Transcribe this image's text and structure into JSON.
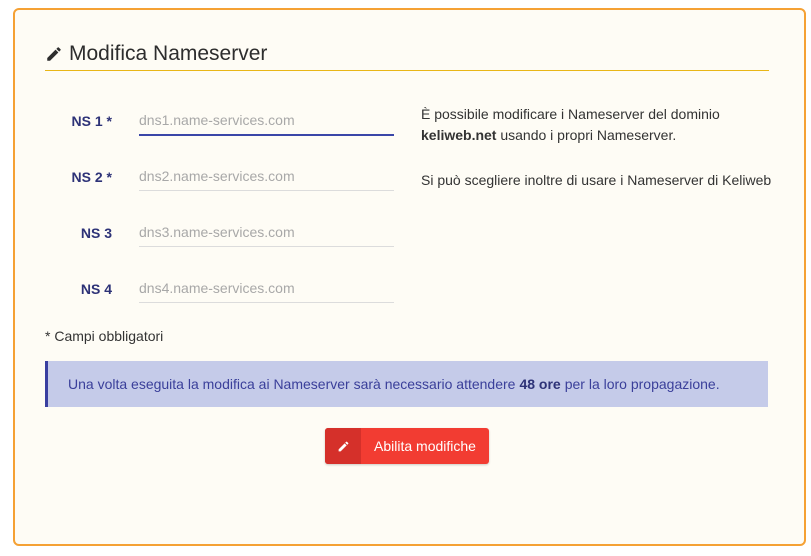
{
  "card": {
    "title": "Modifica Nameserver",
    "title_icon": "pencil-icon"
  },
  "fields": [
    {
      "label": "NS 1 *",
      "placeholder": "dns1.name-services.com",
      "value": "",
      "required": true
    },
    {
      "label": "NS 2 *",
      "placeholder": "dns2.name-services.com",
      "value": "",
      "required": true
    },
    {
      "label": "NS 3",
      "placeholder": "dns3.name-services.com",
      "value": "",
      "required": false
    },
    {
      "label": "NS 4",
      "placeholder": "dns4.name-services.com",
      "value": "",
      "required": false
    }
  ],
  "side_info": {
    "line1_text": "È possibile modificare i Nameserver del dominio",
    "domain": "keliweb.net",
    "line2_rest": "usando i propri Nameserver.",
    "line3": "Si può scegliere inoltre di usare i Nameserver di Keliweb"
  },
  "required_note": "* Campi obbligatori",
  "notice": {
    "before": "Una volta eseguita la modifica ai Nameserver sarà necessario attendere",
    "highlight": "48 ore",
    "after": "per la loro propagazione."
  },
  "enable_button": {
    "label": "Abilita modifiche",
    "icon": "pencil-icon"
  },
  "colors": {
    "border": "#f5a134",
    "card_bg": "#fefcf5",
    "underline": "#e9b617",
    "label": "#2d3277",
    "notice_bg": "#c5cbe9",
    "notice_border": "#3a3fa0",
    "button_bg": "#f23c32",
    "button_icon_bg": "#d5302a"
  }
}
